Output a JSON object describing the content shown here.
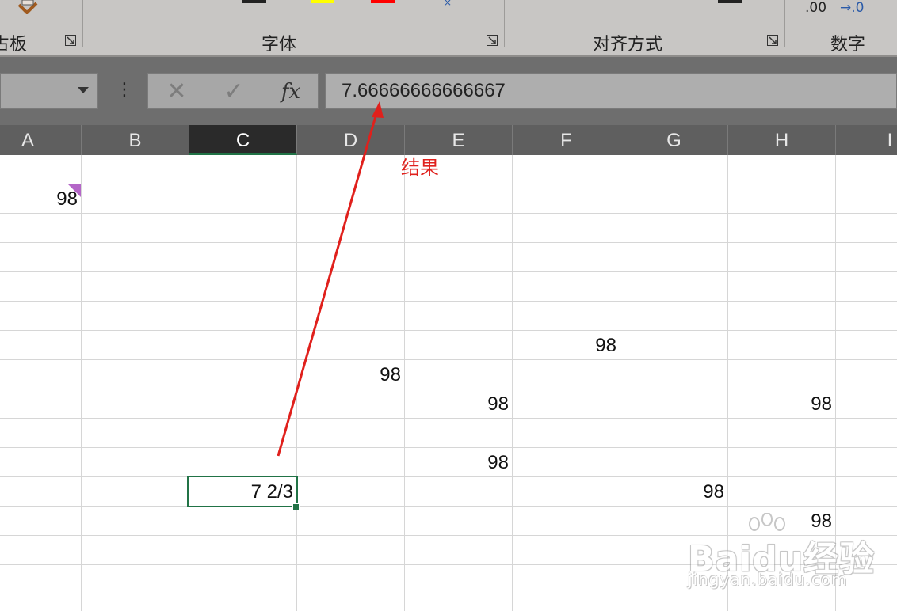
{
  "ribbon": {
    "groups": [
      {
        "label": "占板"
      },
      {
        "label": "字体"
      },
      {
        "label": "对齐方式"
      },
      {
        "label": "数字"
      }
    ],
    "number_format_labels": [
      ".00",
      "→.0"
    ],
    "colors": {
      "font_color_swatch": "#ff0000",
      "highlight_swatch": "#ffff00"
    }
  },
  "formula_bar": {
    "cancel_icon": "✕",
    "enter_icon": "✓",
    "fx_label": "fx",
    "more_icon": "⋮",
    "value": "7.66666666666667"
  },
  "columns": [
    "A",
    "B",
    "C",
    "D",
    "E",
    "F",
    "G",
    "H",
    "I"
  ],
  "selected_column": "C",
  "cells": [
    {
      "ref": "A2",
      "value": "98"
    },
    {
      "ref": "F7",
      "value": "98"
    },
    {
      "ref": "D8",
      "value": "98"
    },
    {
      "ref": "E9",
      "value": "98"
    },
    {
      "ref": "H9",
      "value": "98"
    },
    {
      "ref": "E11",
      "value": "98"
    },
    {
      "ref": "C12",
      "value": "7 2/3"
    },
    {
      "ref": "G12",
      "value": "98"
    },
    {
      "ref": "H13",
      "value": "98"
    }
  ],
  "active_cell": "C12",
  "annotation": {
    "text": "结果",
    "color": "#e0201c"
  },
  "watermark": {
    "brand": "Baidu经验",
    "url": "jingyan.baidu.com"
  }
}
